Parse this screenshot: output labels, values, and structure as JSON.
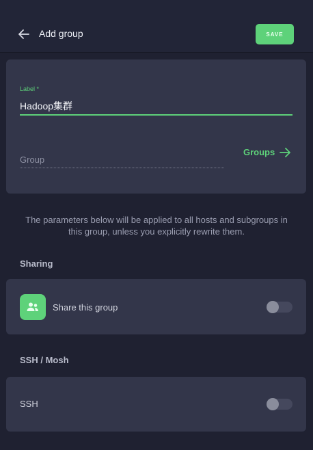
{
  "header": {
    "title": "Add group",
    "save_label": "SAVE"
  },
  "form": {
    "label_caption": "Label *",
    "label_value": "Hadoop集群",
    "group_placeholder": "Group",
    "groups_link": "Groups"
  },
  "info_text": "The parameters below will be applied to all hosts and subgroups in this group, unless you explicitly rewrite them.",
  "sharing": {
    "heading": "Sharing",
    "share_label": "Share this group",
    "share_enabled": false
  },
  "ssh_section": {
    "heading": "SSH / Mosh",
    "ssh_label": "SSH",
    "ssh_enabled": false
  },
  "colors": {
    "accent": "#5ed27a",
    "background": "#1f2131",
    "card": "#33364a"
  },
  "icons": {
    "back": "arrow-left-icon",
    "groups": "arrow-right-icon",
    "share": "users-icon"
  }
}
